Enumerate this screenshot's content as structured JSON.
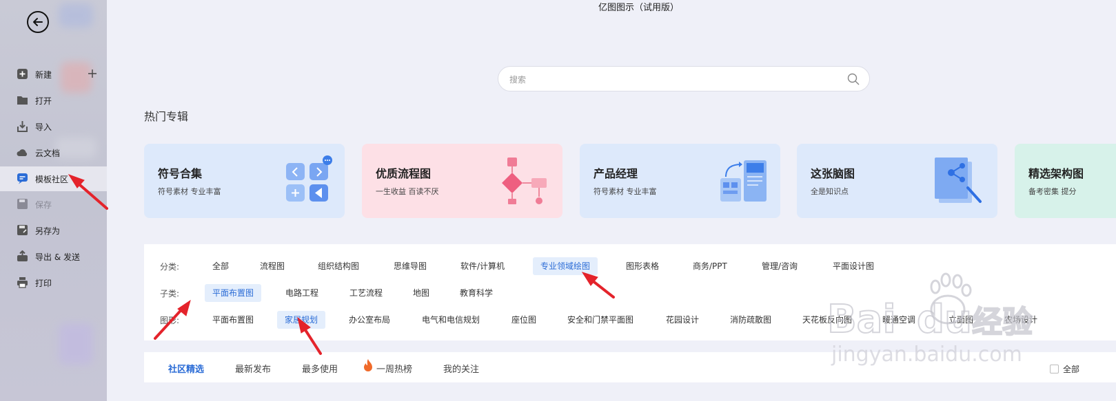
{
  "window": {
    "title": "亿图图示（试用版）"
  },
  "sidebar": {
    "items": [
      {
        "label": "新建"
      },
      {
        "label": "打开"
      },
      {
        "label": "导入"
      },
      {
        "label": "云文档"
      },
      {
        "label": "模板社区"
      },
      {
        "label": "保存"
      },
      {
        "label": "另存为"
      },
      {
        "label": "导出 & 发送"
      },
      {
        "label": "打印"
      }
    ]
  },
  "search": {
    "placeholder": "搜索",
    "value": ""
  },
  "hot": {
    "title": "热门专辑",
    "cards": [
      {
        "title": "符号合集",
        "subtitle": "符号素材 专业丰富",
        "color": "#dde9fb"
      },
      {
        "title": "优质流程图",
        "subtitle": "一生收益 百读不厌",
        "color": "#fde0e6"
      },
      {
        "title": "产品经理",
        "subtitle": "符号素材 专业丰富",
        "color": "#dde9fb"
      },
      {
        "title": "这张脑图",
        "subtitle": "全是知识点",
        "color": "#dde9fb"
      },
      {
        "title": "精选架构图",
        "subtitle": "备考密集 提分",
        "color": "#d7f2ea"
      }
    ]
  },
  "filters": {
    "category": {
      "label": "分类:",
      "items": [
        "全部",
        "流程图",
        "组织结构图",
        "思维导图",
        "软件/计算机",
        "专业领域绘图",
        "图形表格",
        "商务/PPT",
        "管理/咨询",
        "平面设计图"
      ],
      "selected": "专业领域绘图"
    },
    "subcategory": {
      "label": "子类:",
      "items": [
        "平面布置图",
        "电路工程",
        "工艺流程",
        "地图",
        "教育科学"
      ],
      "selected": "平面布置图"
    },
    "shape": {
      "label": "图形:",
      "items": [
        "平面布置图",
        "家居规划",
        "办公室布局",
        "电气和电信规划",
        "座位图",
        "安全和门禁平面图",
        "花园设计",
        "消防疏散图",
        "天花板反向图",
        "暖通空调",
        "立面图",
        "农场设计"
      ],
      "selected": "家居规划"
    }
  },
  "tabs": {
    "items": [
      "社区精选",
      "最新发布",
      "最多使用",
      "一周热榜",
      "我的关注"
    ],
    "active": "社区精选",
    "checkbox_label": "全部"
  },
  "watermark": {
    "brand": "Bai经验",
    "url": "jingyan.baidu.com"
  },
  "colors": {
    "accent": "#2b6cd6",
    "selected_bg": "#e4eefc",
    "annotation_arrow": "#e4232b"
  }
}
